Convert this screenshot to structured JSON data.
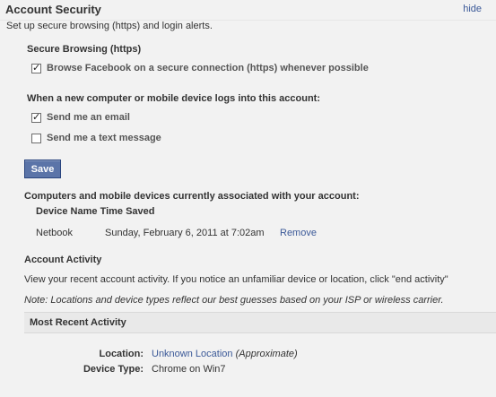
{
  "header": {
    "title": "Account Security",
    "hide_label": "hide"
  },
  "subtitle": "Set up secure browsing (https) and login alerts.",
  "secure_browsing": {
    "heading": "Secure Browsing (https)",
    "option_label": "Browse Facebook on a secure connection (https) whenever possible",
    "checked": true
  },
  "login_alerts": {
    "heading": "When a new computer or mobile device logs into this account:",
    "options": [
      {
        "label": "Send me an email",
        "checked": true
      },
      {
        "label": "Send me a text message",
        "checked": false
      }
    ]
  },
  "save_label": "Save",
  "devices": {
    "heading": "Computers and mobile devices currently associated with your account:",
    "columns": [
      "Device Name",
      "Time Saved"
    ],
    "rows": [
      {
        "name": "Netbook",
        "time_saved": "Sunday, February 6, 2011 at 7:02am",
        "action": "Remove"
      }
    ]
  },
  "account_activity": {
    "heading": "Account Activity",
    "description": "View your recent account activity. If you notice an unfamiliar device or location, click \"end activity\"",
    "note": "Note: Locations and device types reflect our best guesses based on your ISP or wireless carrier."
  },
  "recent_activity": {
    "heading": "Most Recent Activity",
    "location_label": "Location:",
    "location_value": "Unknown Location",
    "location_qualifier": "(Approximate)",
    "device_type_label": "Device Type:",
    "device_type_value": "Chrome on Win7"
  },
  "colors": {
    "link": "#3b5998",
    "button": "#5b74a8",
    "background": "#f2f2f2"
  }
}
